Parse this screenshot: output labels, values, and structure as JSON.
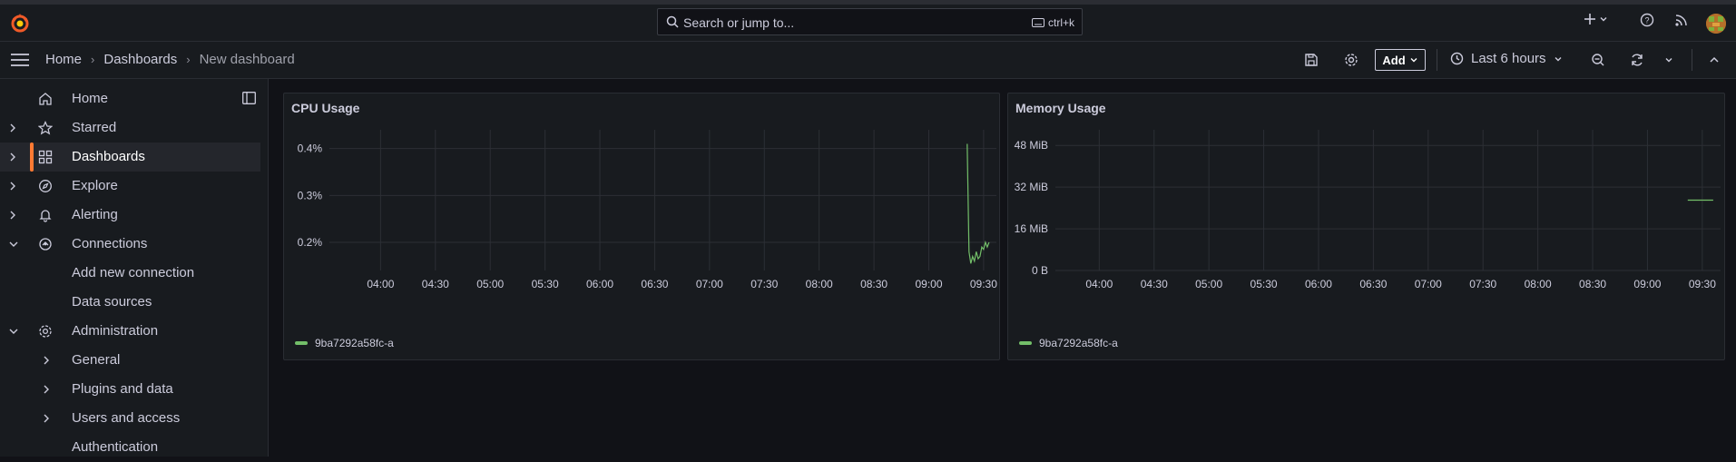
{
  "search": {
    "placeholder": "Search or jump to...",
    "shortcut": "ctrl+k"
  },
  "breadcrumb": {
    "home": "Home",
    "dashboards": "Dashboards",
    "current": "New dashboard"
  },
  "toolbar": {
    "add_label": "Add",
    "time_range": "Last 6 hours"
  },
  "sidebar": {
    "items": [
      {
        "label": "Home",
        "icon": "home-icon"
      },
      {
        "label": "Starred",
        "icon": "star-icon"
      },
      {
        "label": "Dashboards",
        "icon": "dashboards-grid-icon"
      },
      {
        "label": "Explore",
        "icon": "compass-icon"
      },
      {
        "label": "Alerting",
        "icon": "bell-icon"
      },
      {
        "label": "Connections",
        "icon": "connections-icon"
      },
      {
        "label": "Add new connection"
      },
      {
        "label": "Data sources"
      },
      {
        "label": "Administration",
        "icon": "cog-icon"
      },
      {
        "label": "General"
      },
      {
        "label": "Plugins and data"
      },
      {
        "label": "Users and access"
      },
      {
        "label": "Authentication"
      }
    ]
  },
  "colors": {
    "accent": "#ff7a33",
    "series": "#73bf69",
    "background": "#111217",
    "panel": "#181b1f"
  },
  "panels": [
    {
      "title": "CPU Usage",
      "legend": "9ba7292a58fc-a"
    },
    {
      "title": "Memory Usage",
      "legend": "9ba7292a58fc-a"
    }
  ],
  "chart_data": [
    {
      "type": "line",
      "title": "CPU Usage",
      "x_ticks": [
        "04:00",
        "04:30",
        "05:00",
        "05:30",
        "06:00",
        "06:30",
        "07:00",
        "07:30",
        "08:00",
        "08:30",
        "09:00",
        "09:30"
      ],
      "y_ticks": [
        "0.2%",
        "0.3%",
        "0.4%"
      ],
      "ylim": [
        0.14,
        0.44
      ],
      "series": [
        {
          "name": "9ba7292a58fc-a",
          "x": [
            "09:21",
            "09:22",
            "09:23",
            "09:24",
            "09:25",
            "09:26",
            "09:27",
            "09:28",
            "09:29",
            "09:30",
            "09:31",
            "09:32",
            "09:33"
          ],
          "values": [
            0.41,
            0.18,
            0.155,
            0.17,
            0.16,
            0.18,
            0.165,
            0.17,
            0.19,
            0.185,
            0.2,
            0.19,
            0.2
          ]
        }
      ]
    },
    {
      "type": "line",
      "title": "Memory Usage",
      "x_ticks": [
        "04:00",
        "04:30",
        "05:00",
        "05:30",
        "06:00",
        "06:30",
        "07:00",
        "07:30",
        "08:00",
        "08:30",
        "09:00",
        "09:30"
      ],
      "y_ticks": [
        "0 B",
        "16 MiB",
        "32 MiB",
        "48 MiB"
      ],
      "ylim": [
        0,
        54
      ],
      "series": [
        {
          "name": "9ba7292a58fc-a",
          "x": [
            "09:22",
            "09:36"
          ],
          "values": [
            27,
            27
          ]
        }
      ]
    }
  ]
}
